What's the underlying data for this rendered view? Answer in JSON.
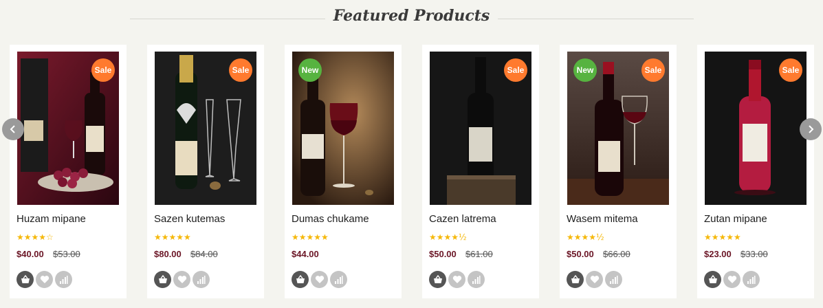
{
  "section": {
    "title": "Featured Products"
  },
  "products": [
    {
      "name": "Huzam mipane",
      "stars": "★★★★☆",
      "price": "$40.00",
      "old_price": "$53.00",
      "badges": [
        "Sale"
      ]
    },
    {
      "name": "Sazen kutemas",
      "stars": "★★★★★",
      "price": "$80.00",
      "old_price": "$84.00",
      "badges": [
        "Sale"
      ]
    },
    {
      "name": "Dumas chukame",
      "stars": "★★★★★",
      "price": "$44.00",
      "old_price": "",
      "badges": [
        "New"
      ]
    },
    {
      "name": "Cazen latrema",
      "stars": "★★★★½",
      "price": "$50.00",
      "old_price": "$61.00",
      "badges": [
        "Sale"
      ]
    },
    {
      "name": "Wasem mitema",
      "stars": "★★★★½",
      "price": "$50.00",
      "old_price": "$66.00",
      "badges": [
        "New",
        "Sale"
      ]
    },
    {
      "name": "Zutan mipane",
      "stars": "★★★★★",
      "price": "$23.00",
      "old_price": "$33.00",
      "badges": [
        "Sale"
      ]
    }
  ],
  "icons": {
    "prev": "chevron-left-icon",
    "next": "chevron-right-icon",
    "cart": "basket-icon",
    "wishlist": "heart-icon",
    "compare": "bar-chart-icon"
  },
  "colors": {
    "sale_badge": "#ff7a2e",
    "new_badge": "#57b340",
    "price": "#6b1626",
    "stars": "#f5b80a"
  }
}
